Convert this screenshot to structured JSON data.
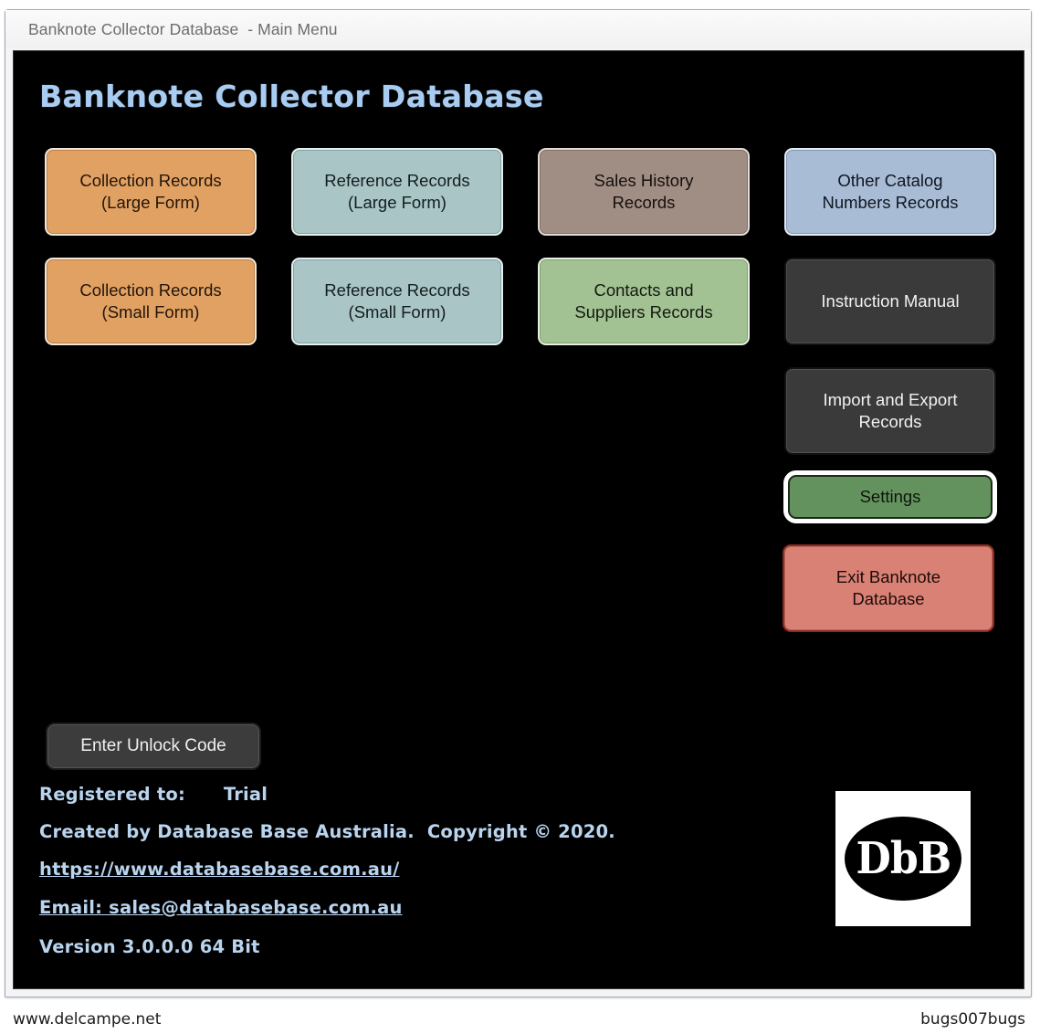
{
  "window": {
    "title": "Banknote Collector Database  - Main Menu"
  },
  "header": {
    "title": "Banknote Collector Database"
  },
  "colors": {
    "background": "#000000",
    "heading_blue": "#a9cdf2",
    "orange": "#e0a163",
    "teal": "#a9c5c6",
    "brown": "#a08e84",
    "slate_blue": "#a9bcd6",
    "green": "#a3c294",
    "dark_gray": "#3a3a3a",
    "settings_green": "#64925e",
    "exit_red": "#da8176",
    "focus_ring": "#ffffff"
  },
  "menu_buttons": [
    {
      "id": "collection-records-large",
      "label": "Collection Records\n(Large Form)",
      "color": "orange",
      "col": 0,
      "row": 0
    },
    {
      "id": "reference-records-large",
      "label": "Reference Records\n(Large Form)",
      "color": "teal",
      "col": 1,
      "row": 0
    },
    {
      "id": "sales-history-records",
      "label": "Sales History\nRecords",
      "color": "brown",
      "col": 2,
      "row": 0
    },
    {
      "id": "other-catalog-numbers-records",
      "label": "Other Catalog\nNumbers Records",
      "color": "slate",
      "col": 3,
      "row": 0
    },
    {
      "id": "collection-records-small",
      "label": "Collection Records\n(Small Form)",
      "color": "orange",
      "col": 0,
      "row": 1
    },
    {
      "id": "reference-records-small",
      "label": "Reference Records\n(Small Form)",
      "color": "teal",
      "col": 1,
      "row": 1
    },
    {
      "id": "contacts-and-suppliers-records",
      "label": "Contacts and\nSuppliers Records",
      "color": "green",
      "col": 2,
      "row": 1
    },
    {
      "id": "instruction-manual",
      "label": "Instruction Manual",
      "color": "dark",
      "col": 3,
      "row": 1
    }
  ],
  "side_buttons": {
    "import_export": "Import and Export\nRecords",
    "settings": "Settings",
    "exit": "Exit Banknote\nDatabase"
  },
  "unlock_button": {
    "label": "Enter Unlock Code"
  },
  "footer": {
    "registered_label": "Registered to:",
    "registered_value": "Trial",
    "registered_line": "Registered to:      Trial",
    "created_by": "Created by Database Base Australia.  Copyright © 2020.",
    "website": "https://www.databasebase.com.au/",
    "email": "Email: sales@databasebase.com.au",
    "version": "Version 3.0.0.0 64 Bit"
  },
  "logo": {
    "text": "DbB"
  },
  "watermarks": {
    "left": "www.delcampe.net",
    "right": "bugs007bugs"
  }
}
